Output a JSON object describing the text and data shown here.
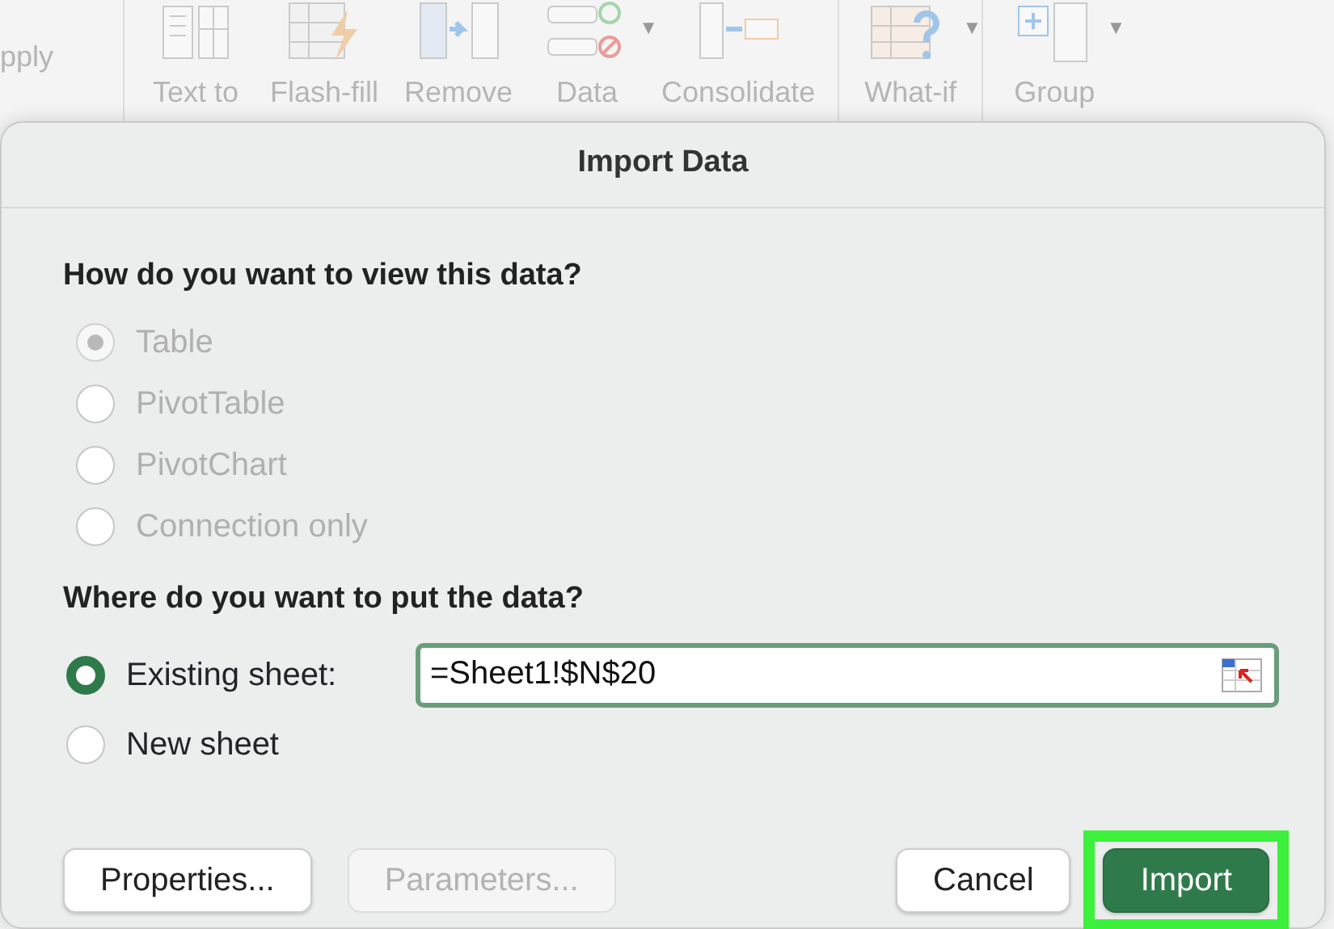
{
  "ribbon": {
    "left_label": "pply",
    "groups": [
      [
        {
          "label": "Text to"
        },
        {
          "label": "Flash-fill"
        },
        {
          "label": "Remove"
        },
        {
          "label": "Data",
          "caret": "▼"
        },
        {
          "label": "Consolidate"
        }
      ],
      [
        {
          "label": "What-if",
          "caret": "▼"
        }
      ],
      [
        {
          "label": "Group",
          "caret": "▼"
        }
      ]
    ]
  },
  "dialog": {
    "title": "Import Data",
    "view_section": {
      "heading": "How do you want to view this data?",
      "options": [
        {
          "label": "Table",
          "selected": true,
          "disabled": true
        },
        {
          "label": "PivotTable",
          "selected": false,
          "disabled": true
        },
        {
          "label": "PivotChart",
          "selected": false,
          "disabled": true
        },
        {
          "label": "Connection only",
          "selected": false,
          "disabled": true
        }
      ]
    },
    "put_section": {
      "heading": "Where do you want to put the data?",
      "options": [
        {
          "label": "Existing sheet:",
          "selected": true,
          "disabled": false,
          "kind": "field",
          "value": "=Sheet1!$N$20"
        },
        {
          "label": "New sheet",
          "selected": false,
          "disabled": false,
          "kind": "plain"
        }
      ]
    },
    "buttons_left": [
      {
        "label": "Properties...",
        "disabled": false
      },
      {
        "label": "Parameters...",
        "disabled": true
      }
    ],
    "buttons_right": [
      {
        "label": "Cancel",
        "disabled": false,
        "primary": false,
        "highlighted": false
      },
      {
        "label": "Import",
        "disabled": false,
        "primary": true,
        "highlighted": true
      }
    ]
  }
}
